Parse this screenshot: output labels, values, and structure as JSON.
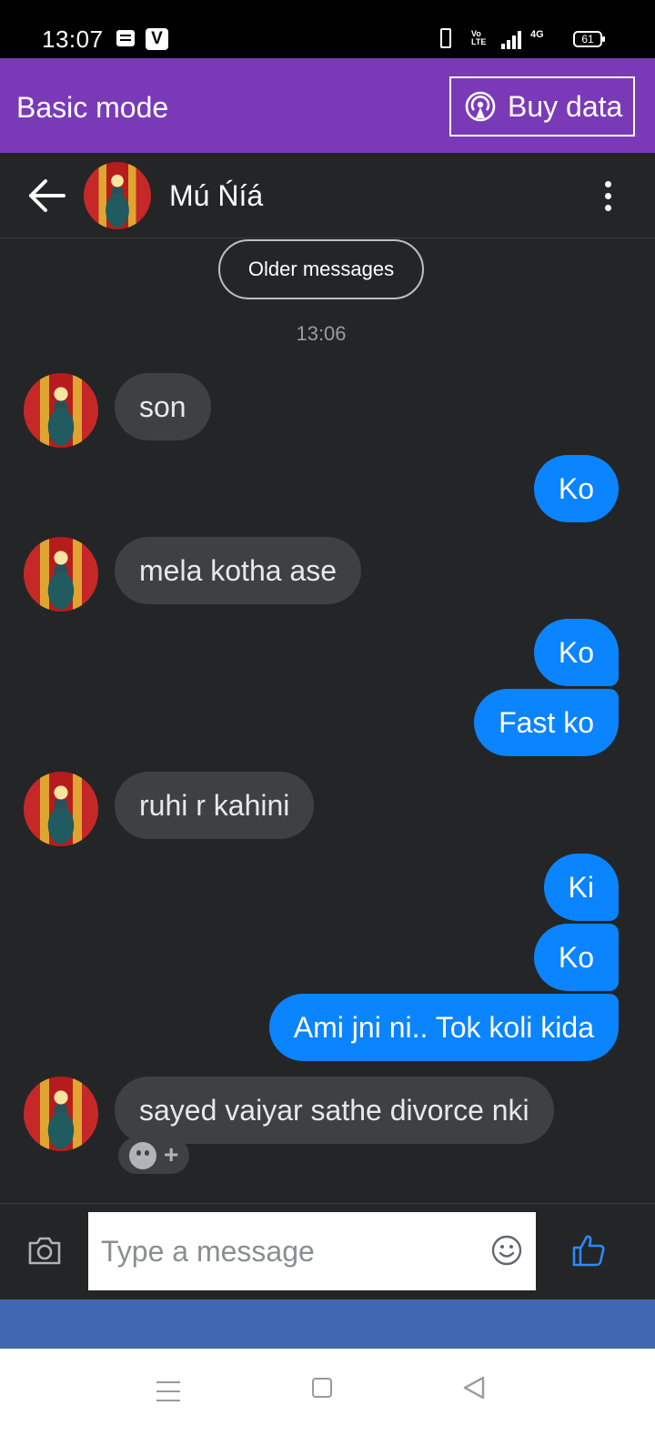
{
  "status_bar": {
    "time": "13:07",
    "battery": "61",
    "network": "4G",
    "volte": "Vo LTE",
    "icons": [
      "notes-icon",
      "v-app-icon",
      "vibrate-icon",
      "volte-icon",
      "signal-icon",
      "4g-signal-icon",
      "battery-icon"
    ]
  },
  "banner": {
    "title": "Basic mode",
    "buy_data_label": "Buy data",
    "bg_color": "#7a3ab8"
  },
  "header": {
    "contact_name": "Mú Ńíá"
  },
  "thread": {
    "older_messages_label": "Older messages",
    "timestamp": "13:06",
    "messages": [
      {
        "direction": "in",
        "text": "son"
      },
      {
        "direction": "out",
        "text": "Ko"
      },
      {
        "direction": "in",
        "text": "mela kotha ase"
      },
      {
        "direction": "out",
        "text": "Ko"
      },
      {
        "direction": "out",
        "text": "Fast ko"
      },
      {
        "direction": "in",
        "text": "ruhi r kahini"
      },
      {
        "direction": "out",
        "text": "Ki"
      },
      {
        "direction": "out",
        "text": "Ko"
      },
      {
        "direction": "out",
        "text": "Ami jni ni.. Tok koli kida"
      },
      {
        "direction": "in",
        "text": "sayed vaiyar sathe divorce nki"
      }
    ],
    "outgoing_color": "#0a84ff",
    "incoming_color": "#3e4042"
  },
  "composer": {
    "placeholder": "Type a message"
  },
  "nav_bar": {
    "icons": [
      "menu-icon",
      "home-icon",
      "back-triangle-icon"
    ]
  }
}
